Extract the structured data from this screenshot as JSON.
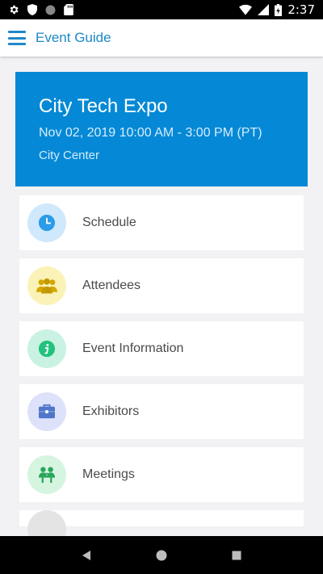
{
  "status_bar": {
    "time": "2:37",
    "icons": [
      "gear-icon",
      "shield-icon",
      "circle-icon",
      "sd-card-icon",
      "wifi-icon",
      "signal-icon",
      "battery-icon"
    ]
  },
  "app_bar": {
    "title": "Event Guide",
    "menu_icon": "hamburger-menu-icon"
  },
  "event": {
    "title": "City Tech Expo",
    "date": "Nov 02, 2019 10:00 AM - 3:00 PM (PT)",
    "location": "City Center"
  },
  "menu": {
    "items": [
      {
        "label": "Schedule",
        "icon": "clock-icon",
        "circle_color": "#cfe8fb",
        "icon_color": "#2c9be8"
      },
      {
        "label": "Attendees",
        "icon": "people-icon",
        "circle_color": "#fbf2b8",
        "icon_color": "#d4a800"
      },
      {
        "label": "Event Information",
        "icon": "info-icon",
        "circle_color": "#c9f2e2",
        "icon_color": "#22c27e"
      },
      {
        "label": "Exhibitors",
        "icon": "briefcase-icon",
        "circle_color": "#dee1fa",
        "icon_color": "#4f76c9"
      },
      {
        "label": "Meetings",
        "icon": "meeting-icon",
        "circle_color": "#d6f5e1",
        "icon_color": "#2aa55c"
      }
    ]
  },
  "colors": {
    "accent": "#1e88c7",
    "header_bg": "#0589d6",
    "page_bg": "#f2f2f4"
  },
  "nav_bar": {
    "icons": [
      "back-icon",
      "home-icon",
      "recents-icon"
    ]
  }
}
